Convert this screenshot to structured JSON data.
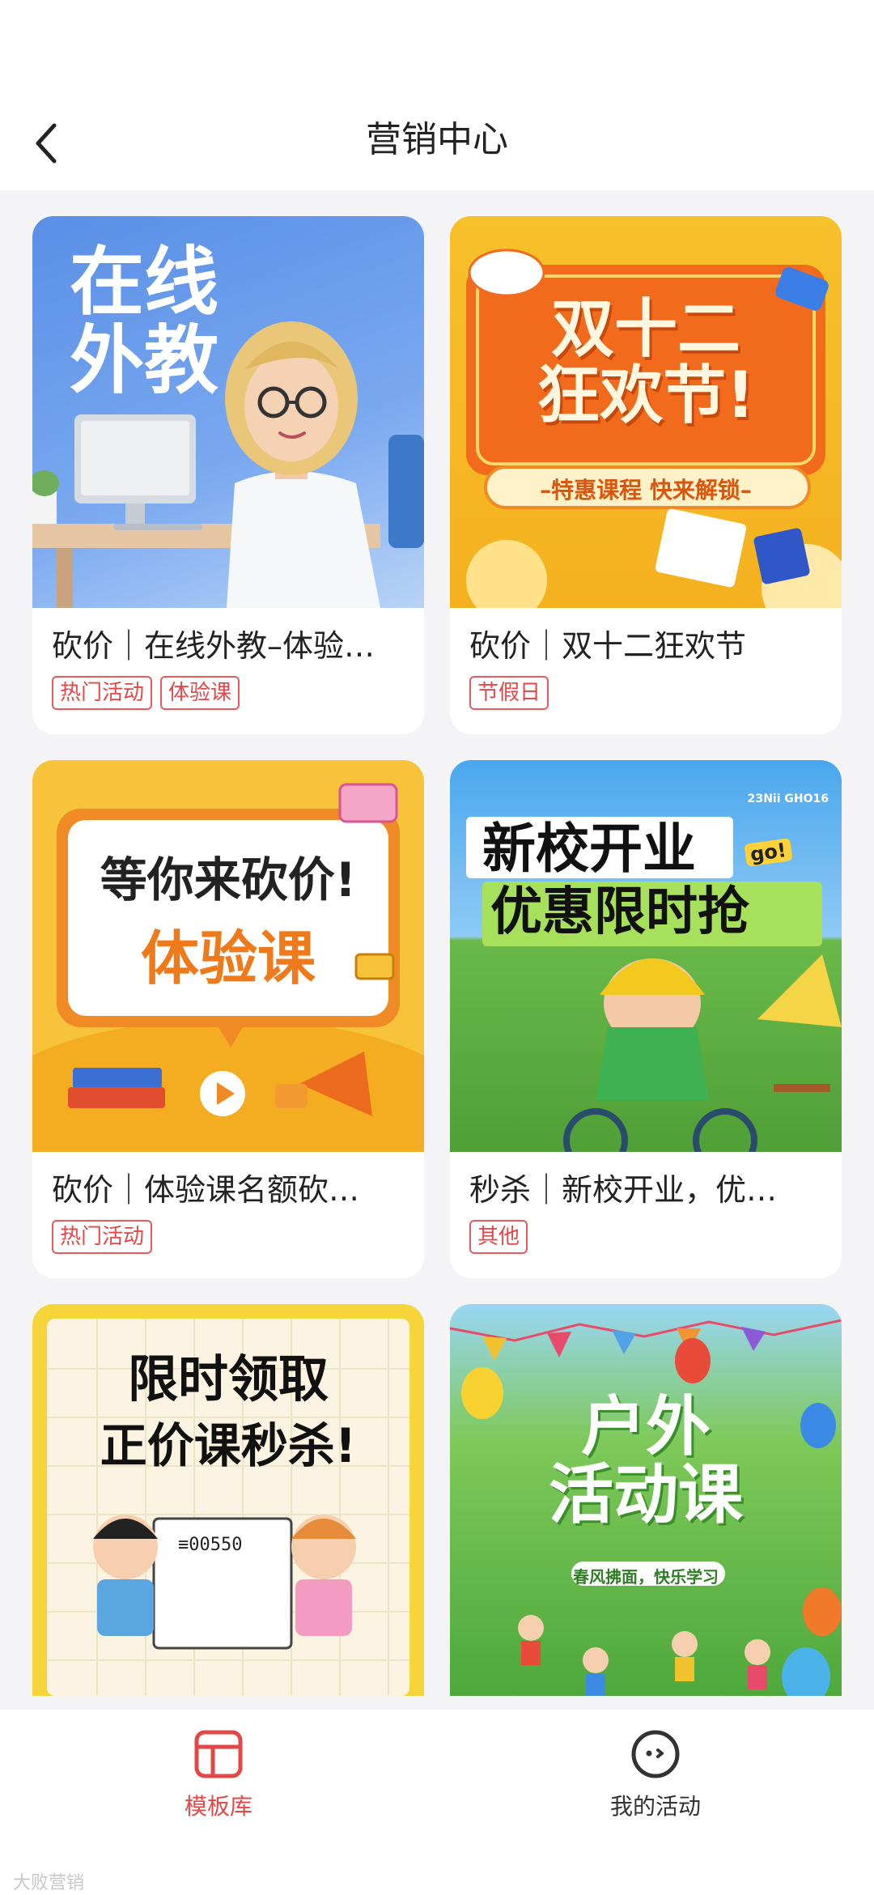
{
  "header": {
    "title": "营销中心"
  },
  "cards": [
    {
      "title": "砍价｜在线外教–体验…",
      "tags": [
        "热门活动",
        "体验课"
      ],
      "thumb_text": [
        "在线",
        "外教"
      ]
    },
    {
      "title": "砍价｜双十二狂欢节",
      "tags": [
        "节假日"
      ],
      "thumb_text": [
        "双十二",
        "狂欢节!"
      ],
      "thumb_sub": "–特惠课程 快来解锁–"
    },
    {
      "title": "砍价｜体验课名额砍…",
      "tags": [
        "热门活动"
      ],
      "thumb_text": [
        "等你来砍价!",
        "体验课"
      ]
    },
    {
      "title": "秒杀｜新校开业，优…",
      "tags": [
        "其他"
      ],
      "thumb_text": [
        "新校开业",
        "优惠限时抢"
      ],
      "thumb_small": "2ЗNii GHO16",
      "thumb_badge": "go!"
    },
    {
      "title": "",
      "tags": [],
      "thumb_text": [
        "限时领取",
        "正价课秒杀!"
      ],
      "thumb_small": "≡00550"
    },
    {
      "title": "",
      "tags": [],
      "thumb_text": [
        "户外",
        "活动课"
      ],
      "thumb_sub": "春风拂面，快乐学习"
    }
  ],
  "tabbar": {
    "tabs": [
      {
        "label": "模板库",
        "active": true
      },
      {
        "label": "我的活动",
        "active": false
      }
    ],
    "active_color": "#e24848",
    "inactive_color": "#333333"
  },
  "watermark": "大败营销"
}
